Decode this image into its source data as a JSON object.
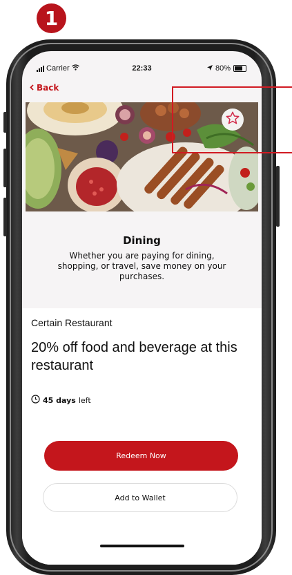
{
  "step": {
    "number": "1"
  },
  "status_bar": {
    "carrier": "Carrier",
    "time": "22:33",
    "battery": "80%"
  },
  "nav": {
    "back_label": "Back"
  },
  "category": {
    "title": "Dining",
    "description": "Whether you are paying for dining, shopping, or travel, save money on your purchases."
  },
  "offer": {
    "merchant": "Certain Restaurant",
    "title": "20% off food and beverage at this restaurant",
    "days": "45 days",
    "days_suffix": " left"
  },
  "actions": {
    "redeem_label": "Redeem Now",
    "wallet_label": "Add to Wallet"
  },
  "colors": {
    "brand_red": "#c4161c",
    "callout_red": "#d11a22"
  },
  "icons": [
    "signal-icon",
    "wifi-icon",
    "location-arrow-icon",
    "battery-icon",
    "back-chevron-icon",
    "star-icon",
    "clock-icon"
  ]
}
